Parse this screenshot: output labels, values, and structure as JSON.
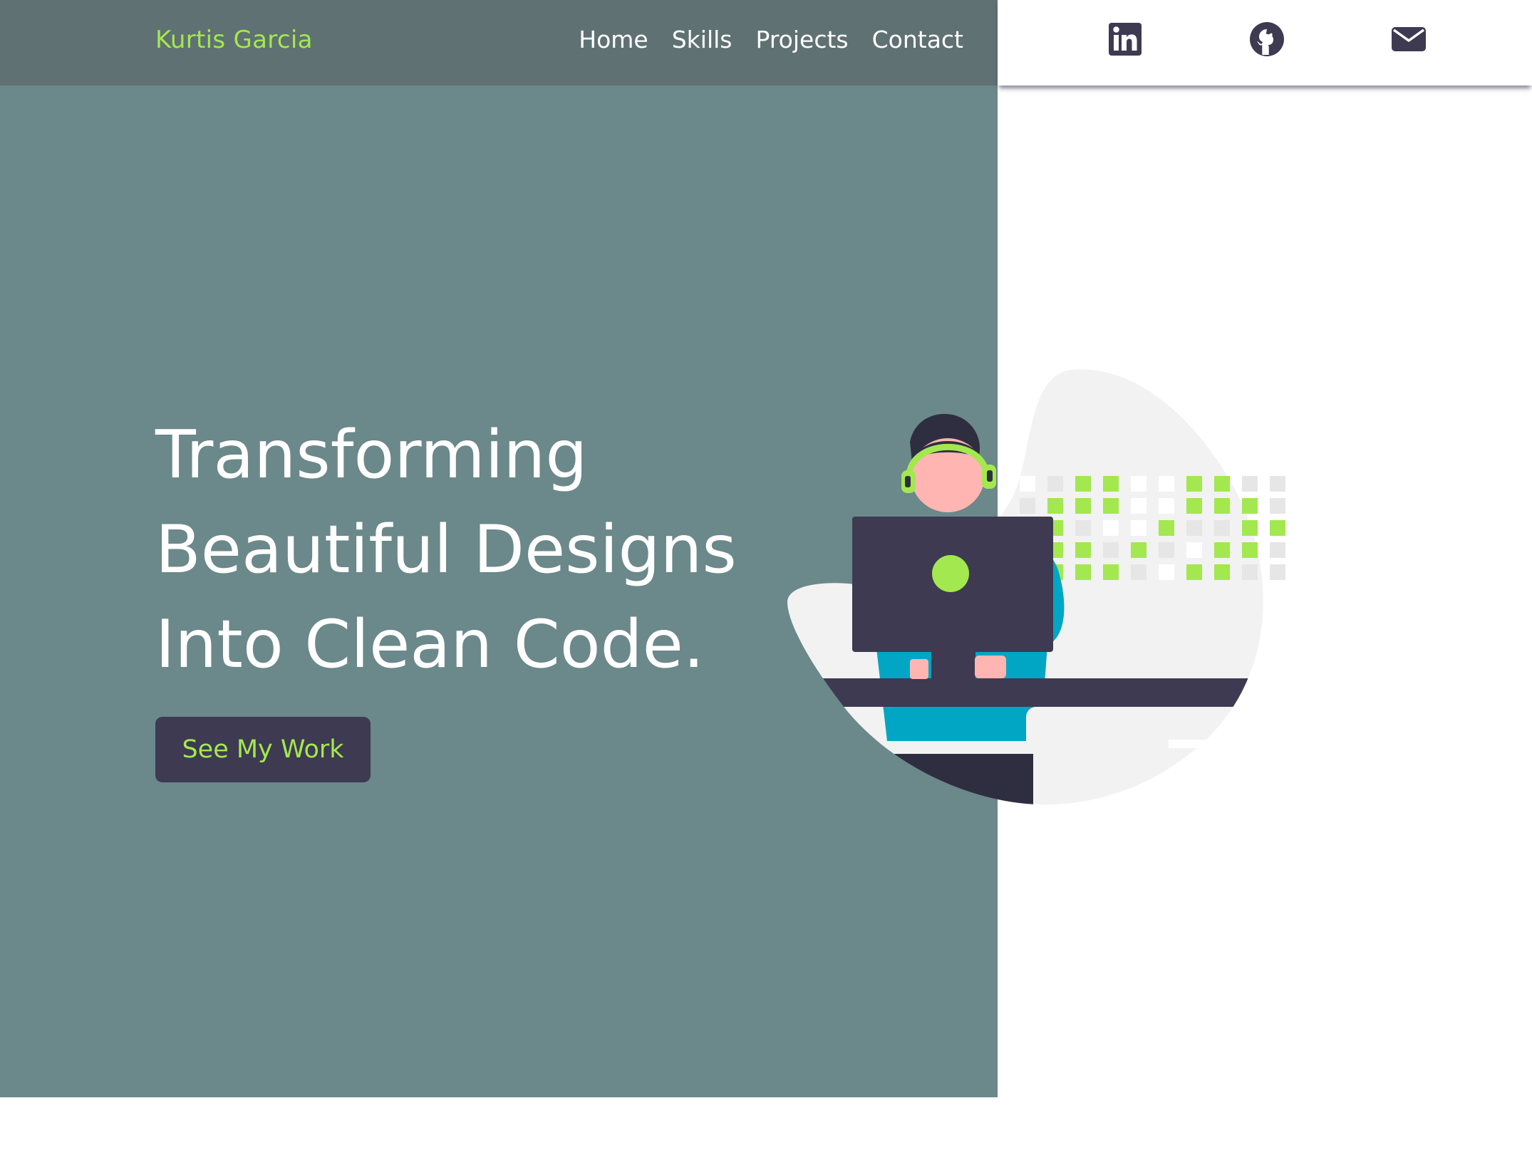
{
  "brand": {
    "name": "Kurtis Garcia"
  },
  "nav": {
    "items": [
      {
        "label": "Home"
      },
      {
        "label": "Skills"
      },
      {
        "label": "Projects"
      },
      {
        "label": "Contact"
      }
    ]
  },
  "social": {
    "icons": [
      "linkedin-icon",
      "github-icon",
      "envelope-icon"
    ]
  },
  "hero": {
    "headline_lines": [
      "Transforming",
      "Beautiful Designs",
      "Into Clean Code."
    ],
    "cta_label": "See My Work"
  },
  "colors": {
    "hero_background": "#6b888a",
    "navbar_background": "#5f7173",
    "accent_green": "#a3e84f",
    "dark_navy": "#3d3a51",
    "teal": "#00a6c3",
    "skin": "#ffb6b2"
  }
}
